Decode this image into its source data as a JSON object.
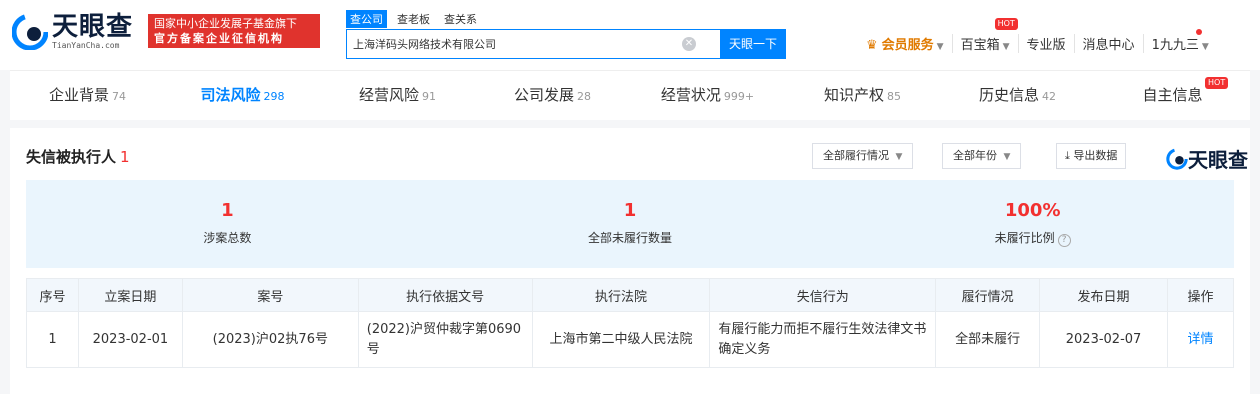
{
  "logo": {
    "cn": "天眼查",
    "en": "TianYanCha.com"
  },
  "badge": {
    "line1": "国家中小企业发展子基金旗下",
    "line2": "官方备案企业征信机构"
  },
  "search": {
    "tabs": [
      "查公司",
      "查老板",
      "查关系"
    ],
    "value": "上海洋码头网络技术有限公司",
    "clear": "✕",
    "button": "天眼一下"
  },
  "topnav": {
    "member": "会员服务",
    "treasure": "百宝箱",
    "hot": "HOT",
    "pro": "专业版",
    "messages": "消息中心",
    "user": "1九九三"
  },
  "tabs": [
    {
      "label": "企业背景",
      "count": "74"
    },
    {
      "label": "司法风险",
      "count": "298"
    },
    {
      "label": "经营风险",
      "count": "91"
    },
    {
      "label": "公司发展",
      "count": "28"
    },
    {
      "label": "经营状况",
      "count": "999+"
    },
    {
      "label": "知识产权",
      "count": "85"
    },
    {
      "label": "历史信息",
      "count": "42"
    },
    {
      "label": "自主信息",
      "count": ""
    }
  ],
  "section": {
    "title": "失信被执行人",
    "count": "1",
    "filter_status": "全部履行情况",
    "filter_year": "全部年份",
    "export": "导出数据",
    "brand": "天眼查"
  },
  "stats": [
    {
      "value": "1",
      "label": "涉案总数"
    },
    {
      "value": "1",
      "label": "全部未履行数量"
    },
    {
      "value": "100%",
      "label": "未履行比例"
    }
  ],
  "table": {
    "headers": [
      "序号",
      "立案日期",
      "案号",
      "执行依据文号",
      "执行法院",
      "失信行为",
      "履行情况",
      "发布日期",
      "操作"
    ],
    "rows": [
      [
        "1",
        "2023-02-01",
        "(2023)沪02执76号",
        "(2022)沪贸仲裁字第0690号",
        "上海市第二中级人民法院",
        "有履行能力而拒不履行生效法律文书确定义务",
        "全部未履行",
        "2023-02-07",
        "详情"
      ]
    ]
  }
}
